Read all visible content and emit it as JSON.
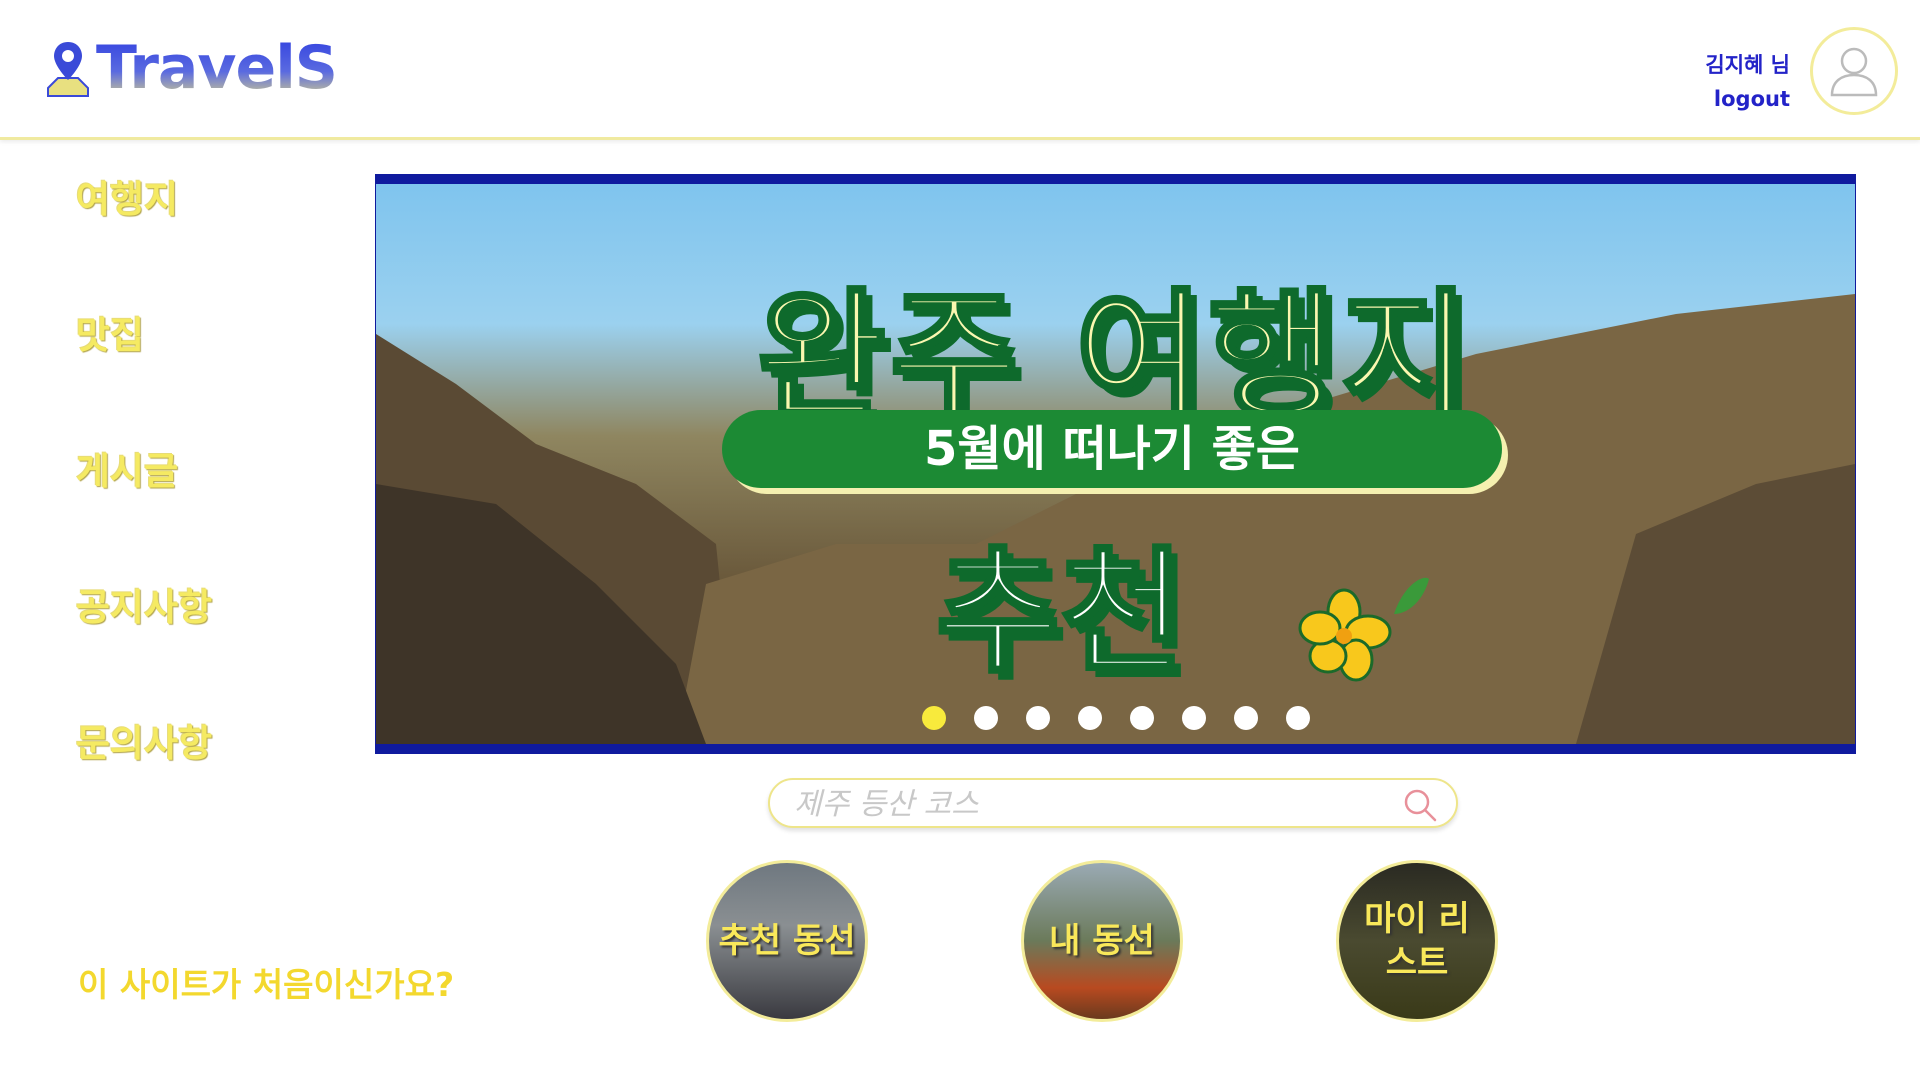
{
  "header": {
    "logo_text": "TravelS",
    "user_name": "김지혜 님",
    "logout_label": "logout"
  },
  "sidebar": {
    "items": [
      {
        "label": "여행지"
      },
      {
        "label": "맛집"
      },
      {
        "label": "게시글"
      },
      {
        "label": "공지사항"
      },
      {
        "label": "문의사항"
      }
    ]
  },
  "banner": {
    "title": "완주 여행지",
    "pill": "5월에 떠나기 좋은",
    "subtitle": "추천",
    "slide_count": 8,
    "active_slide": 1
  },
  "search": {
    "placeholder": "제주 등산 코스"
  },
  "intro_text": "이 사이트가 처음이신가요?",
  "quick_links": [
    {
      "label": "추천 동선"
    },
    {
      "label": "내 동선"
    },
    {
      "label": "마이 리스트"
    }
  ],
  "colors": {
    "brand_blue": "#2323c8",
    "accent_yellow": "#f5ea62",
    "banner_border": "#0f1a9e",
    "active_dot": "#f8ea3c"
  }
}
